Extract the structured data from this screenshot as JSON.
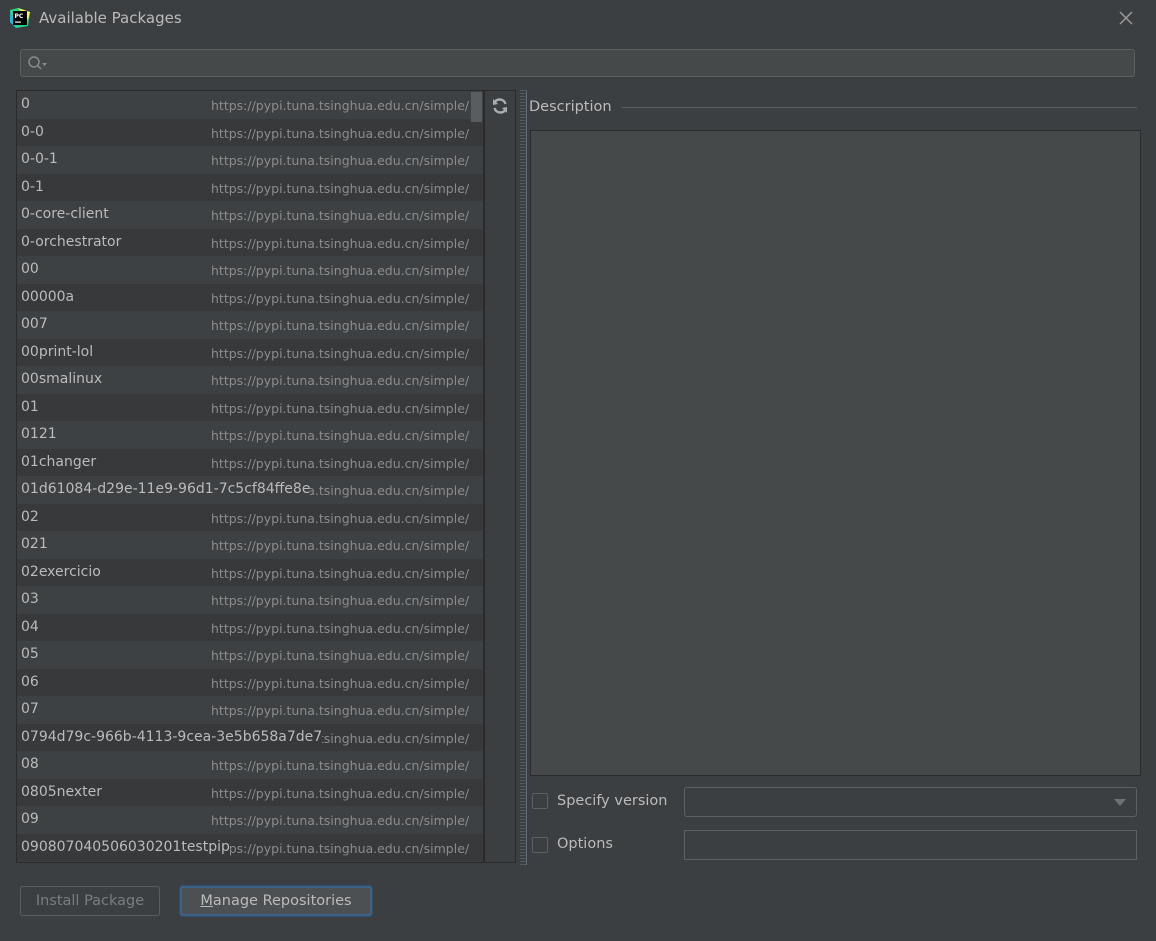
{
  "window": {
    "title": "Available Packages",
    "app_icon": "pycharm-icon",
    "close_icon": "close-icon"
  },
  "search": {
    "value": "",
    "placeholder": "",
    "icon": "search-icon"
  },
  "packages": [
    {
      "name": "0",
      "repo": "https://pypi.tuna.tsinghua.edu.cn/simple/"
    },
    {
      "name": "0-0",
      "repo": "https://pypi.tuna.tsinghua.edu.cn/simple/"
    },
    {
      "name": "0-0-1",
      "repo": "https://pypi.tuna.tsinghua.edu.cn/simple/"
    },
    {
      "name": "0-1",
      "repo": "https://pypi.tuna.tsinghua.edu.cn/simple/"
    },
    {
      "name": "0-core-client",
      "repo": "https://pypi.tuna.tsinghua.edu.cn/simple/"
    },
    {
      "name": "0-orchestrator",
      "repo": "https://pypi.tuna.tsinghua.edu.cn/simple/"
    },
    {
      "name": "00",
      "repo": "https://pypi.tuna.tsinghua.edu.cn/simple/"
    },
    {
      "name": "00000a",
      "repo": "https://pypi.tuna.tsinghua.edu.cn/simple/"
    },
    {
      "name": "007",
      "repo": "https://pypi.tuna.tsinghua.edu.cn/simple/"
    },
    {
      "name": "00print-lol",
      "repo": "https://pypi.tuna.tsinghua.edu.cn/simple/"
    },
    {
      "name": "00smalinux",
      "repo": "https://pypi.tuna.tsinghua.edu.cn/simple/"
    },
    {
      "name": "01",
      "repo": "https://pypi.tuna.tsinghua.edu.cn/simple/"
    },
    {
      "name": "0121",
      "repo": "https://pypi.tuna.tsinghua.edu.cn/simple/"
    },
    {
      "name": "01changer",
      "repo": "https://pypi.tuna.tsinghua.edu.cn/simple/"
    },
    {
      "name": "01d61084-d29e-11e9-96d1-7c5cf84ffe8e",
      "repo": "https://pypi.tuna.tsinghua.edu.cn/simple/"
    },
    {
      "name": "02",
      "repo": "https://pypi.tuna.tsinghua.edu.cn/simple/"
    },
    {
      "name": "021",
      "repo": "https://pypi.tuna.tsinghua.edu.cn/simple/"
    },
    {
      "name": "02exercicio",
      "repo": "https://pypi.tuna.tsinghua.edu.cn/simple/"
    },
    {
      "name": "03",
      "repo": "https://pypi.tuna.tsinghua.edu.cn/simple/"
    },
    {
      "name": "04",
      "repo": "https://pypi.tuna.tsinghua.edu.cn/simple/"
    },
    {
      "name": "05",
      "repo": "https://pypi.tuna.tsinghua.edu.cn/simple/"
    },
    {
      "name": "06",
      "repo": "https://pypi.tuna.tsinghua.edu.cn/simple/"
    },
    {
      "name": "07",
      "repo": "https://pypi.tuna.tsinghua.edu.cn/simple/"
    },
    {
      "name": "0794d79c-966b-4113-9cea-3e5b658a7de7",
      "repo": "https://pypi.tuna.tsinghua.edu.cn/simple/"
    },
    {
      "name": "08",
      "repo": "https://pypi.tuna.tsinghua.edu.cn/simple/"
    },
    {
      "name": "0805nexter",
      "repo": "https://pypi.tuna.tsinghua.edu.cn/simple/"
    },
    {
      "name": "09",
      "repo": "https://pypi.tuna.tsinghua.edu.cn/simple/"
    },
    {
      "name": "090807040506030201testpip",
      "repo": "https://pypi.tuna.tsinghua.edu.cn/simple/"
    }
  ],
  "toolbar": {
    "refresh_icon": "refresh-icon"
  },
  "description": {
    "label": "Description",
    "content": ""
  },
  "options": {
    "specify_version_label": "Specify version",
    "specify_version_checked": false,
    "version_value": "",
    "options_label": "Options",
    "options_checked": false,
    "options_value": ""
  },
  "buttons": {
    "install_label": "Install Package",
    "manage_mnemonic": "M",
    "manage_rest": "anage Repositories"
  },
  "colors": {
    "background": "#3c3f41",
    "focus_border": "#3d6185",
    "text": "#bbbbbb",
    "muted_text": "#8c8c8c"
  }
}
